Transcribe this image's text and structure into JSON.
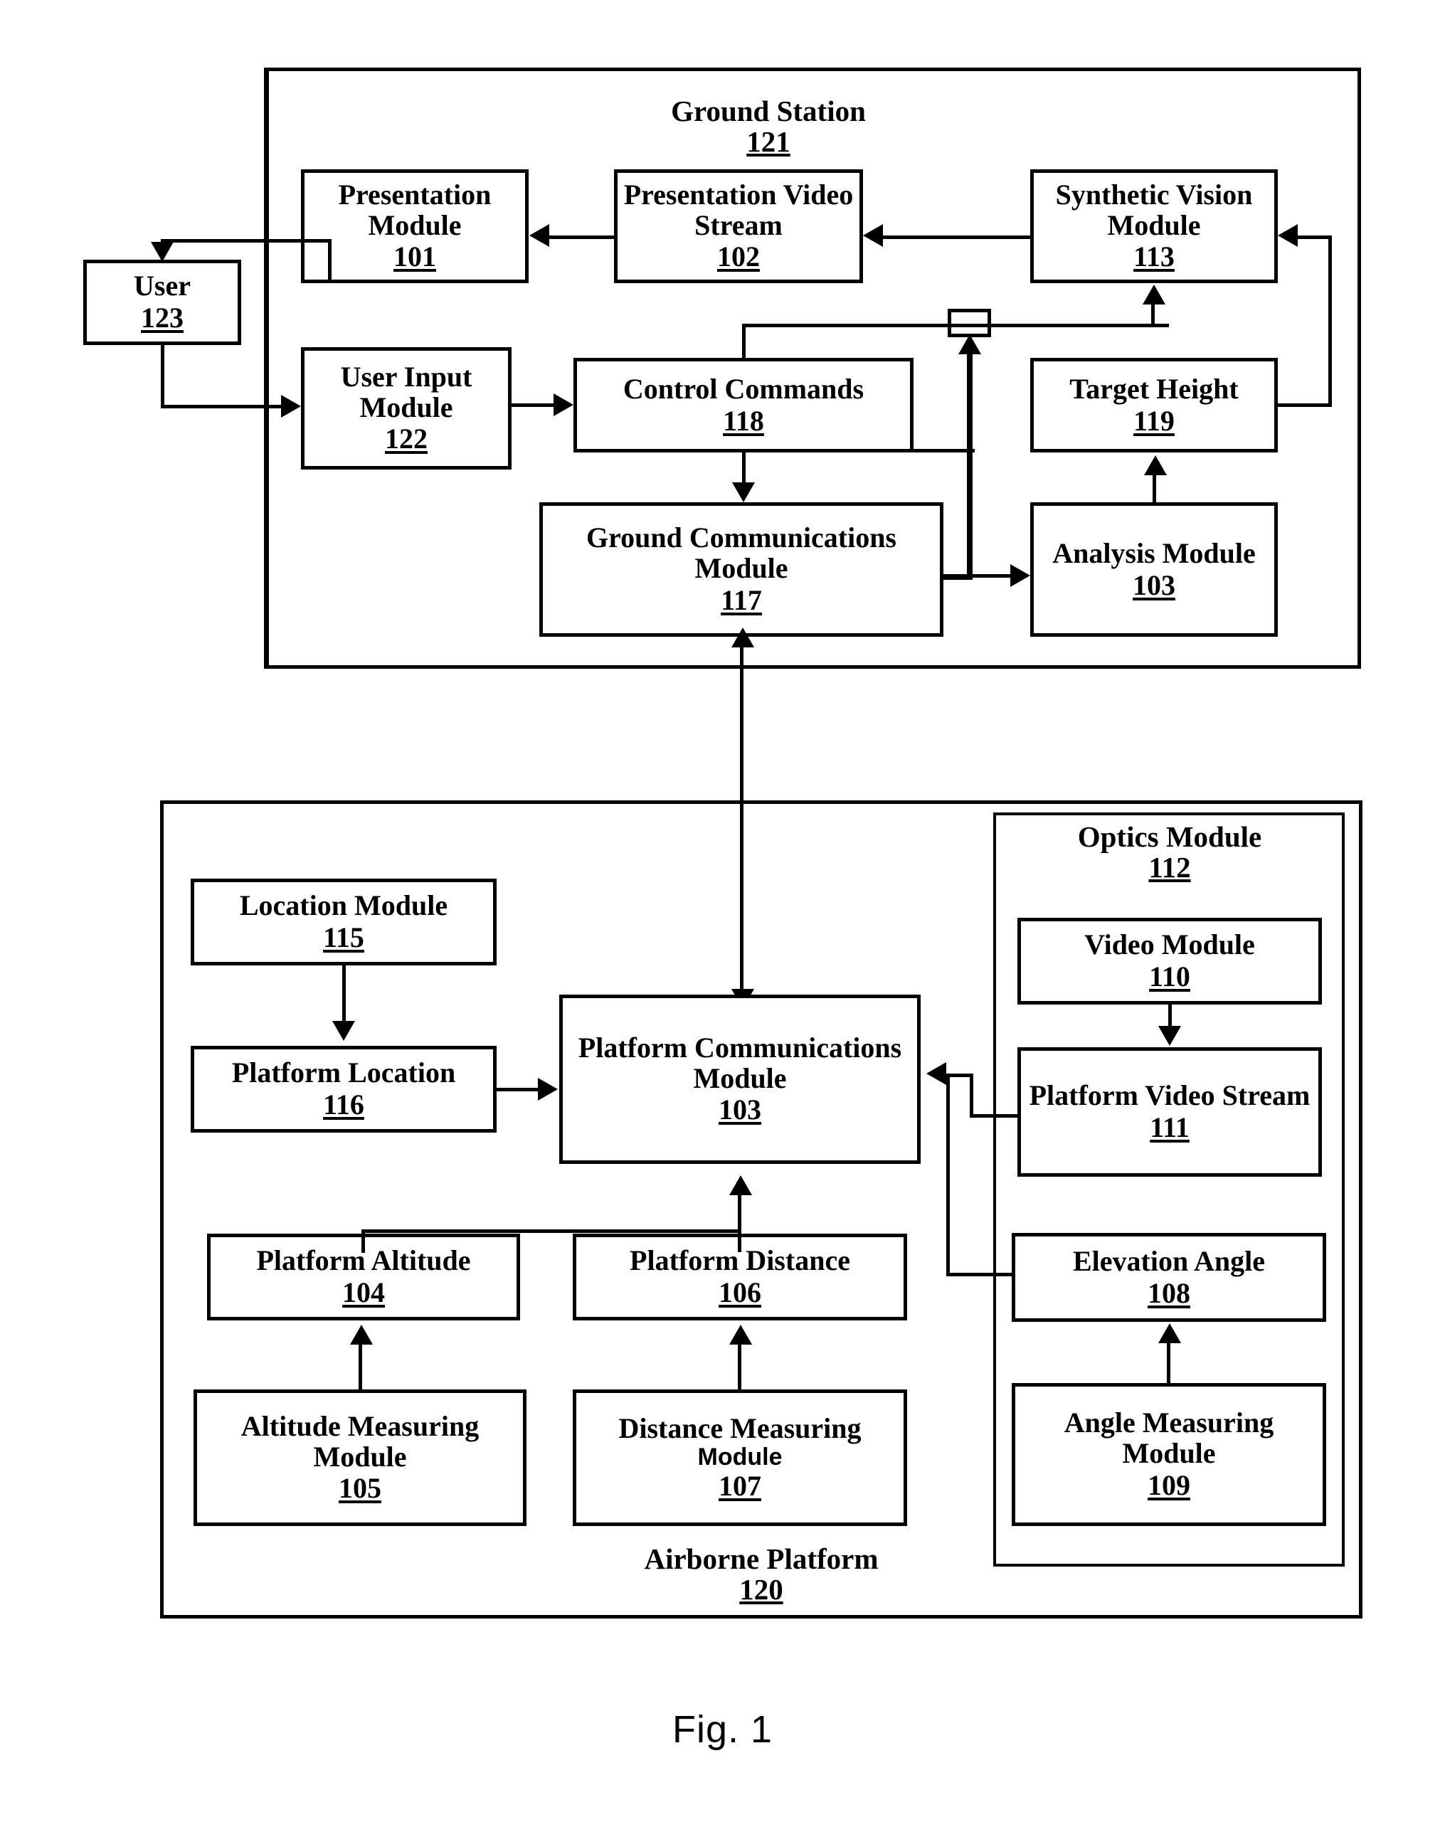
{
  "figure": {
    "caption": "Fig. 1"
  },
  "groups": {
    "ground_station": {
      "label": "Ground Station",
      "ref": "121"
    },
    "airborne_platform": {
      "label": "Airborne Platform",
      "ref": "120"
    },
    "optics_module": {
      "label": "Optics Module",
      "ref": "112"
    }
  },
  "blocks": {
    "user": {
      "label": "User",
      "ref": "123"
    },
    "presentation_module": {
      "label": "Presentation Module",
      "ref": "101"
    },
    "presentation_video": {
      "label": "Presentation Video Stream",
      "ref": "102"
    },
    "synthetic_vision": {
      "label": "Synthetic Vision Module",
      "ref": "113"
    },
    "user_input_module": {
      "label": "User Input Module",
      "ref": "122"
    },
    "control_commands": {
      "label": "Control Commands",
      "ref": "118"
    },
    "target_height": {
      "label": "Target Height",
      "ref": "119"
    },
    "ground_comms": {
      "label": "Ground Communications Module",
      "ref": "117"
    },
    "analysis_module": {
      "label": "Analysis Module",
      "ref": "103"
    },
    "location_module": {
      "label": "Location Module",
      "ref": "115"
    },
    "platform_location": {
      "label": "Platform Location",
      "ref": "116"
    },
    "platform_comms": {
      "label": "Platform Communications Module",
      "ref": "103"
    },
    "video_module": {
      "label": "Video Module",
      "ref": "110"
    },
    "platform_video_stream": {
      "label": "Platform Video Stream",
      "ref": "111"
    },
    "platform_altitude": {
      "label": "Platform Altitude",
      "ref": "104"
    },
    "platform_distance": {
      "label": "Platform Distance",
      "ref": "106"
    },
    "elevation_angle": {
      "label": "Elevation Angle",
      "ref": "108"
    },
    "altitude_measuring": {
      "label": "Altitude Measuring Module",
      "ref": "105"
    },
    "distance_measuring": {
      "label_line1": "Distance Measuring",
      "label_line2": "Module",
      "ref": "107"
    },
    "angle_measuring": {
      "label": "Angle Measuring Module",
      "ref": "109"
    }
  },
  "colors": {
    "stroke": "#000000",
    "background": "#ffffff"
  }
}
